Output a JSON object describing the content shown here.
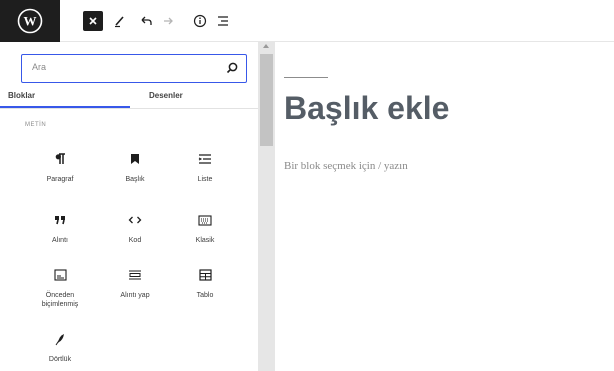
{
  "toolbar": {
    "logo_icon": "wordpress-icon",
    "close_icon": "close-icon",
    "tools_icon": "pencil-icon",
    "undo_icon": "undo-icon",
    "redo_icon": "redo-icon",
    "info_icon": "info-icon",
    "outline_icon": "list-view-icon"
  },
  "inserter": {
    "search": {
      "placeholder": "Ara",
      "icon": "search-icon"
    },
    "tabs": [
      {
        "label": "Bloklar",
        "active": true
      },
      {
        "label": "Desenler",
        "active": false
      }
    ],
    "category": "METİN",
    "blocks": [
      {
        "label": "Paragraf",
        "icon": "paragraph-icon"
      },
      {
        "label": "Başlık",
        "icon": "bookmark-icon"
      },
      {
        "label": "Liste",
        "icon": "list-icon"
      },
      {
        "label": "Alıntı",
        "icon": "quote-icon"
      },
      {
        "label": "Kod",
        "icon": "code-icon"
      },
      {
        "label": "Klasik",
        "icon": "keyboard-icon"
      },
      {
        "label": "Önceden biçimlenmiş",
        "icon": "preformatted-icon"
      },
      {
        "label": "Alıntı yap",
        "icon": "pullquote-icon"
      },
      {
        "label": "Tablo",
        "icon": "table-icon"
      },
      {
        "label": "Dörtlük",
        "icon": "feather-icon"
      }
    ]
  },
  "editor": {
    "title": "Başlık ekle",
    "placeholder": "Bir blok seçmek için / yazın"
  },
  "colors": {
    "accent": "#3858e9",
    "dark": "#1e1e1e",
    "title": "#555d66"
  }
}
